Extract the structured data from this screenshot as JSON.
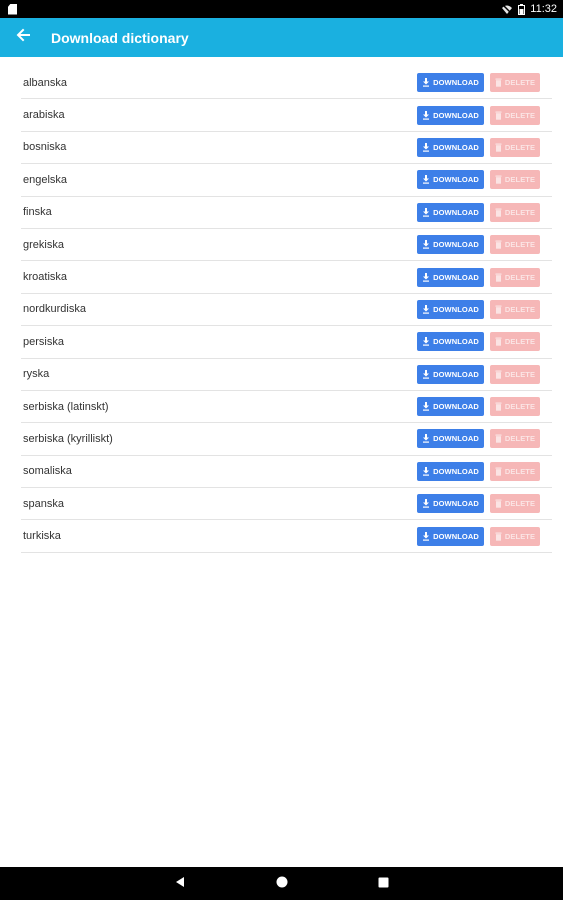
{
  "status_bar": {
    "time": "11:32"
  },
  "app_bar": {
    "title": "Download dictionary"
  },
  "buttons": {
    "download_label": "DOWNLOAD",
    "delete_label": "DELETE"
  },
  "languages": [
    "albanska",
    "arabiska",
    "bosniska",
    "engelska",
    "finska",
    "grekiska",
    "kroatiska",
    "nordkurdiska",
    "persiska",
    "ryska",
    "serbiska (latinskt)",
    "serbiska (kyrilliskt)",
    "somaliska",
    "spanska",
    "turkiska"
  ],
  "colors": {
    "app_bar": "#1ab0e0",
    "download": "#3d7fe8",
    "delete_disabled": "#f6b7b7"
  },
  "icons": {
    "back": "arrow-left-icon",
    "download": "download-icon",
    "delete": "trash-icon",
    "nav_back": "nav-back-icon",
    "nav_home": "nav-home-icon",
    "nav_recents": "nav-recents-icon"
  }
}
